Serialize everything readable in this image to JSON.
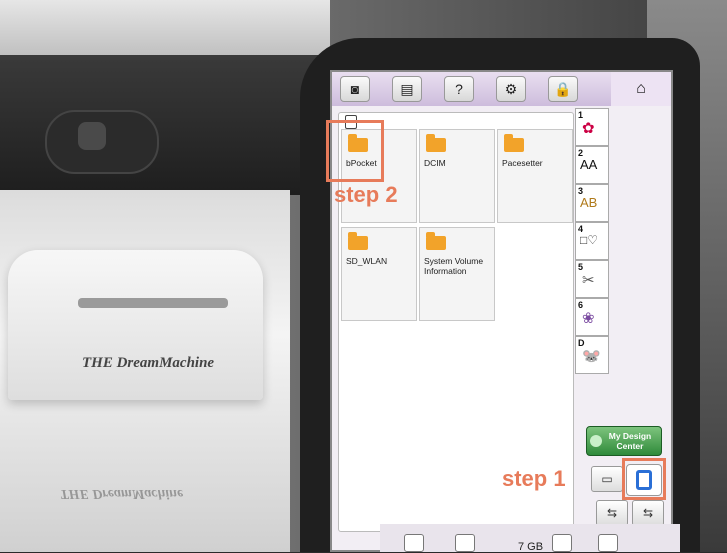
{
  "lcd": {
    "toolbar": [
      {
        "icon": "camera-icon",
        "glyph": "◙"
      },
      {
        "icon": "document-icon",
        "glyph": "▤"
      },
      {
        "icon": "help-icon",
        "glyph": "?"
      },
      {
        "icon": "settings-icon",
        "glyph": "⚙"
      },
      {
        "icon": "lock-icon",
        "glyph": "🔒"
      }
    ],
    "home_glyph": "⌂",
    "folders": [
      {
        "label": "bPocket"
      },
      {
        "label": "DCIM"
      },
      {
        "label": "Pacesetter"
      },
      {
        "label": "SD_WLAN"
      },
      {
        "label": "System Volume Information"
      }
    ],
    "categories": [
      {
        "num": "1",
        "glyph": "✿"
      },
      {
        "num": "2",
        "glyph": "AA"
      },
      {
        "num": "3",
        "glyph": "AB"
      },
      {
        "num": "4",
        "glyph": "□♡"
      },
      {
        "num": "5",
        "glyph": "✂"
      },
      {
        "num": "6",
        "glyph": "❀"
      },
      {
        "num": "D",
        "glyph": "🐭"
      }
    ],
    "my_design_center": "My Design Center",
    "usb_glyph": "⇆",
    "storage": "7 GB"
  },
  "annotations": {
    "step1": "step 1",
    "step2": "step 2",
    "accent": "#e77b5a"
  },
  "machine": {
    "brand": "THE DreamMachine"
  }
}
